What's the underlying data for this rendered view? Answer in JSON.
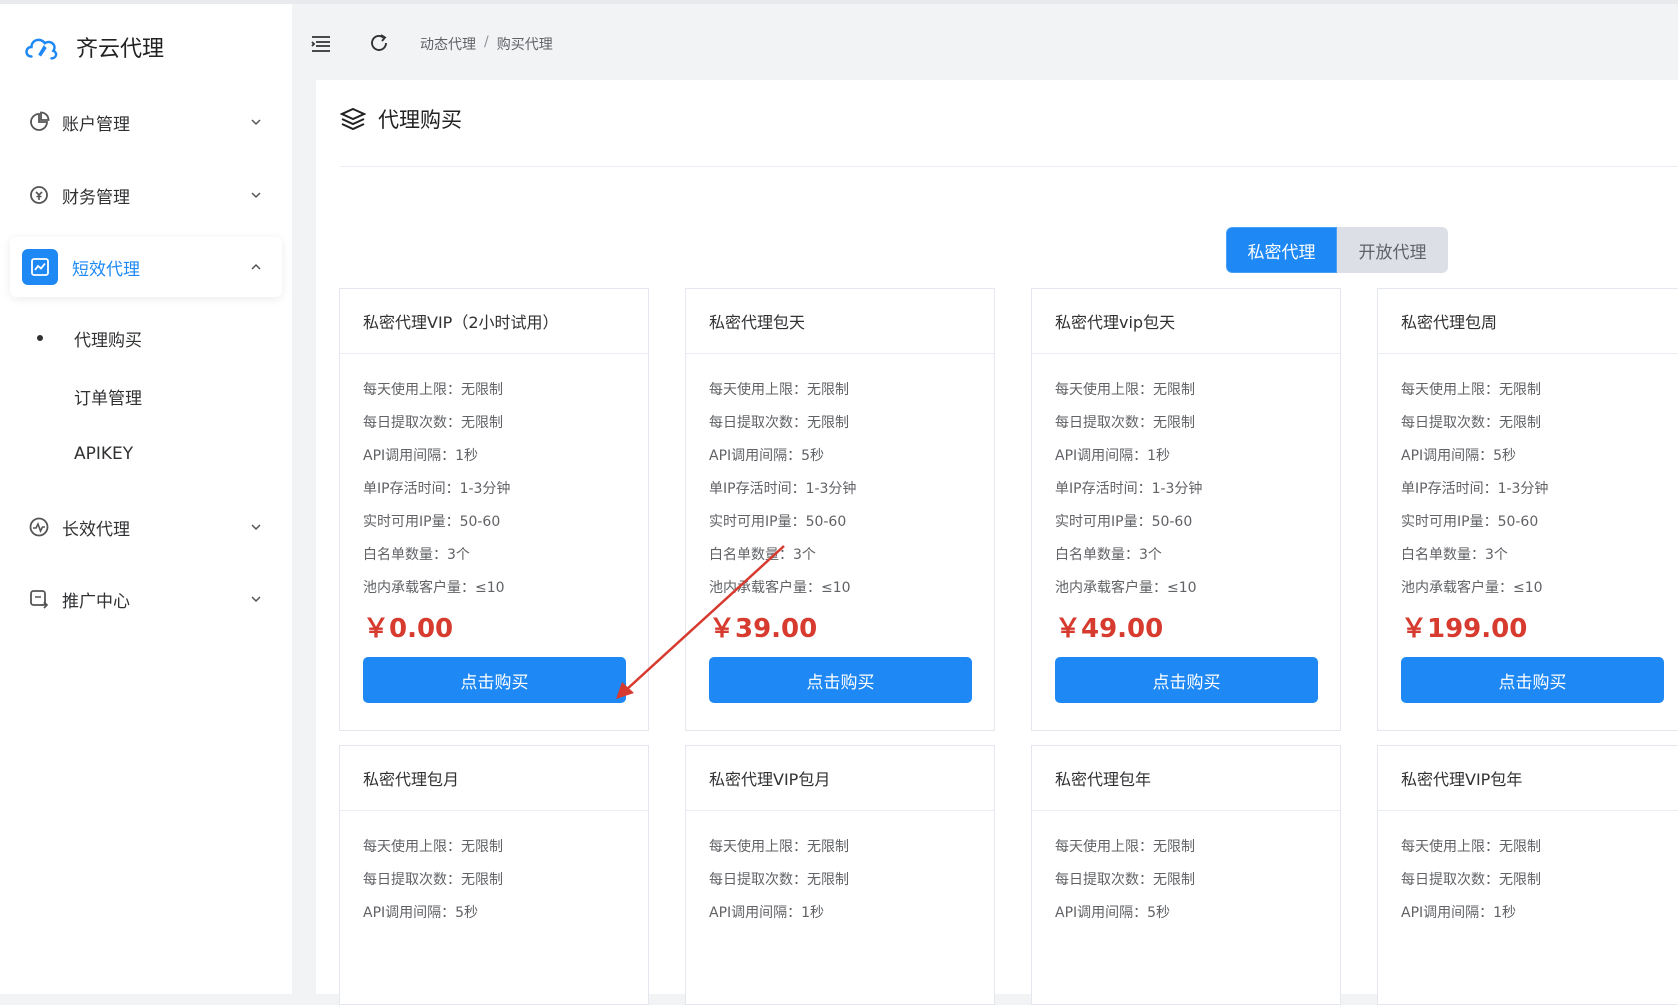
{
  "app": {
    "name": "齐云代理"
  },
  "sidebar": {
    "items": [
      {
        "label": "账户管理"
      },
      {
        "label": "财务管理"
      },
      {
        "label": "短效代理",
        "active": true,
        "children": [
          {
            "label": "代理购买",
            "current": true
          },
          {
            "label": "订单管理"
          },
          {
            "label": "APIKEY"
          }
        ]
      },
      {
        "label": "长效代理"
      },
      {
        "label": "推广中心"
      }
    ]
  },
  "header": {
    "breadcrumb": [
      "动态代理",
      "购买代理"
    ],
    "separator": "/"
  },
  "page": {
    "title": "代理购买",
    "toggle": {
      "active": "私密代理",
      "inactive": "开放代理"
    },
    "buy_label": "点击购买",
    "colors": {
      "accent": "#1e88f5",
      "price": "#d73a2e"
    }
  },
  "cards": [
    {
      "title": "私密代理VIP（2小时试用）",
      "features": [
        "每天使用上限：无限制",
        "每日提取次数：无限制",
        "API调用间隔：1秒",
        "单IP存活时间：1-3分钟",
        "实时可用IP量：50-60",
        "白名单数量：3个",
        "池内承载客户量：≤10"
      ],
      "price": "￥0.00"
    },
    {
      "title": "私密代理包天",
      "features": [
        "每天使用上限：无限制",
        "每日提取次数：无限制",
        "API调用间隔：5秒",
        "单IP存活时间：1-3分钟",
        "实时可用IP量：50-60",
        "白名单数量：3个",
        "池内承载客户量：≤10"
      ],
      "price": "￥39.00"
    },
    {
      "title": "私密代理vip包天",
      "features": [
        "每天使用上限：无限制",
        "每日提取次数：无限制",
        "API调用间隔：1秒",
        "单IP存活时间：1-3分钟",
        "实时可用IP量：50-60",
        "白名单数量：3个",
        "池内承载客户量：≤10"
      ],
      "price": "￥49.00"
    },
    {
      "title": "私密代理包周",
      "features": [
        "每天使用上限：无限制",
        "每日提取次数：无限制",
        "API调用间隔：5秒",
        "单IP存活时间：1-3分钟",
        "实时可用IP量：50-60",
        "白名单数量：3个",
        "池内承载客户量：≤10"
      ],
      "price": "￥199.00"
    },
    {
      "title": "私密代理包月",
      "features": [
        "每天使用上限：无限制",
        "每日提取次数：无限制",
        "API调用间隔：5秒"
      ]
    },
    {
      "title": "私密代理VIP包月",
      "features": [
        "每天使用上限：无限制",
        "每日提取次数：无限制",
        "API调用间隔：1秒"
      ]
    },
    {
      "title": "私密代理包年",
      "features": [
        "每天使用上限：无限制",
        "每日提取次数：无限制",
        "API调用间隔：5秒"
      ]
    },
    {
      "title": "私密代理VIP包年",
      "features": [
        "每天使用上限：无限制",
        "每日提取次数：无限制",
        "API调用间隔：1秒"
      ]
    }
  ]
}
